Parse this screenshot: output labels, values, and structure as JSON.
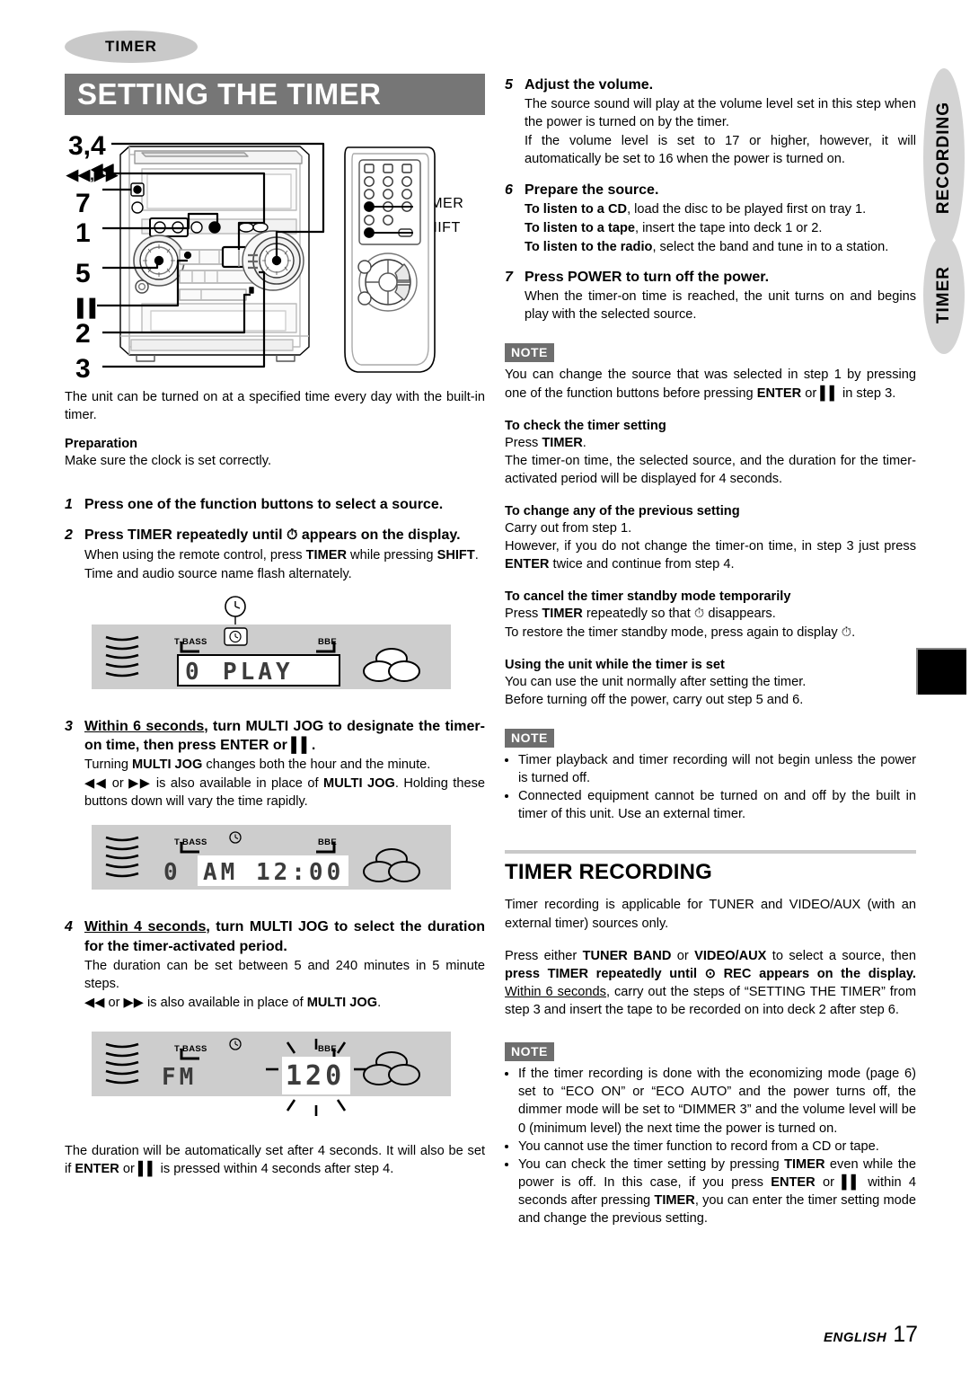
{
  "chapter_tab": "TIMER",
  "title": "SETTING THE TIMER",
  "figure": {
    "callouts": [
      {
        "label": "3,4"
      },
      {
        "label": "◀◀,▶▶"
      },
      {
        "label": "7"
      },
      {
        "label": "1"
      },
      {
        "label": "5"
      },
      {
        "label": "▌▌"
      },
      {
        "label": "2"
      },
      {
        "label": "3"
      }
    ],
    "remote_labels": [
      "TIMER",
      "SHIFT"
    ]
  },
  "intro": "The unit can be turned on at a specified time every day with the built-in timer.",
  "preparation": {
    "heading": "Preparation",
    "text": "Make sure the clock is set correctly."
  },
  "steps_left": [
    {
      "num": "1",
      "title": "Press one of the function buttons to select a source.",
      "sub": []
    },
    {
      "num": "2",
      "title_pre": "Press TIMER repeatedly until ",
      "title_post": " appears on the display.",
      "sub": [
        "When using the remote control, press TIMER while pressing SHIFT.",
        "Time and audio source name flash alternately."
      ]
    },
    {
      "num": "3",
      "title_u": "Within 6 seconds",
      "title_rest": ", turn MULTI JOG to designate the timer-on time, then press ENTER or ▌▌.",
      "sub": [
        "Turning MULTI JOG changes both the hour and the minute.",
        "◀◀ or ▶▶ is also available in place of MULTI JOG. Holding these buttons down will vary the time rapidly."
      ]
    },
    {
      "num": "4",
      "title_u": "Within 4 seconds",
      "title_rest": ", turn MULTI JOG to select the duration for the timer-activated period.",
      "sub": [
        "The duration can be set between 5 and 240 minutes in 5 minute steps.",
        "◀◀ or ▶▶ is also available in place of MULTI JOG."
      ]
    }
  ],
  "displays": [
    {
      "name": "display-play",
      "tbass": "T-BASS",
      "bbe": "BBE",
      "clock_icon": "clock-icon",
      "clock_boxed": true,
      "segment_left": "0",
      "segment_main": "PLAY",
      "highlight": "main"
    },
    {
      "name": "display-am-12-00",
      "tbass": "T-BASS",
      "bbe": "BBE",
      "clock_icon": "clock-icon",
      "clock_boxed": false,
      "segment_left": "0",
      "segment_main": "AM 12:00",
      "highlight": "main"
    },
    {
      "name": "display-fm-120",
      "tbass": "T-BASS",
      "bbe": "BBE",
      "clock_icon": "clock-icon",
      "clock_boxed": false,
      "segment_left": "FM",
      "segment_main": "120",
      "highlight": "flashing"
    }
  ],
  "after_step4": "The duration will be automatically set after 4 seconds. It will also be set if ENTER or ▌▌ is pressed within 4 seconds after step 4.",
  "steps_right": [
    {
      "num": "5",
      "title": "Adjust the volume.",
      "sub": [
        "The source sound will play at the volume level set in this step when the power is turned on by the timer.",
        "If the volume level is set to 17 or higher, however, it will automatically be set to 16 when the power is turned on."
      ]
    },
    {
      "num": "6",
      "title": "Prepare the source.",
      "sub_rich": [
        {
          "bold": "To listen to a CD",
          "rest": ", load the disc to be played first on tray 1."
        },
        {
          "bold": "To listen to a tape",
          "rest": ", insert the tape into deck 1 or 2."
        },
        {
          "bold": "To listen to the radio",
          "rest": ", select the band and tune in to a station."
        }
      ]
    },
    {
      "num": "7",
      "title": "Press POWER to turn off the power.",
      "sub": [
        "When the timer-on time is reached, the unit turns on and begins play with the selected source."
      ]
    }
  ],
  "note1": {
    "badge": "NOTE",
    "text": "You can change the source that was selected in step 1 by pressing one of the function buttons before pressing ENTER or ▌▌ in step 3."
  },
  "sections_right": [
    {
      "heading": "To check the timer setting",
      "lines": [
        "Press TIMER.",
        "The timer-on time, the selected source, and the duration for the timer-activated period will be displayed for 4 seconds."
      ]
    },
    {
      "heading": "To change any of the previous setting",
      "lines": [
        "Carry out from step 1.",
        "However, if you do not change the timer-on time, in step 3 just press ENTER twice and continue from step 4."
      ]
    },
    {
      "heading": "To cancel the timer standby mode temporarily",
      "lines": [
        "Press TIMER repeatedly so that ⊙ disappears.",
        "To restore the timer standby mode, press again to display ⊙."
      ]
    },
    {
      "heading": "Using the unit while the timer is set",
      "lines": [
        "You can use the unit normally after setting the timer.",
        "Before turning off the power, carry out step 5 and 6."
      ]
    }
  ],
  "note2": {
    "badge": "NOTE",
    "items": [
      "Timer playback and timer recording will not begin unless the power is turned off.",
      "Connected equipment cannot be turned on and off by the built in timer of this unit.  Use an external timer."
    ]
  },
  "timer_recording": {
    "heading": "TIMER RECORDING",
    "p1": "Timer recording is applicable for TUNER and VIDEO/AUX (with an external timer) sources only.",
    "p2_a": "Press either ",
    "p2_b": "TUNER BAND",
    "p2_c": " or ",
    "p2_d": "VIDEO/AUX",
    "p2_e": " to select a source, then ",
    "p2_f": "press TIMER repeatedly until ⊙ REC appears on the display.",
    "p2_g": " ",
    "p2_h": "Within 6 seconds",
    "p2_i": ", carry out the steps of “SETTING THE TIMER” from step 3 and insert the tape to be recorded on into deck 2 after step 6."
  },
  "note3": {
    "badge": "NOTE",
    "items": [
      "If the timer recording is done with the economizing mode (page 6) set to “ECO ON” or “ECO AUTO” and the power turns off, the dimmer mode will be set to “DIMMER 3” and the volume level will be 0 (minimum level) the next time the power is turned on.",
      "You cannot use the timer function to record from a CD or tape.",
      "You can check the timer setting by pressing TIMER even while the power is off. In this case, if you press ENTER or ▌▌ within 4 seconds after pressing TIMER, you can enter the timer setting mode and change the previous setting."
    ]
  },
  "edge_tabs": [
    "RECORDING",
    "TIMER"
  ],
  "footer": {
    "language": "ENGLISH",
    "page": "17"
  }
}
